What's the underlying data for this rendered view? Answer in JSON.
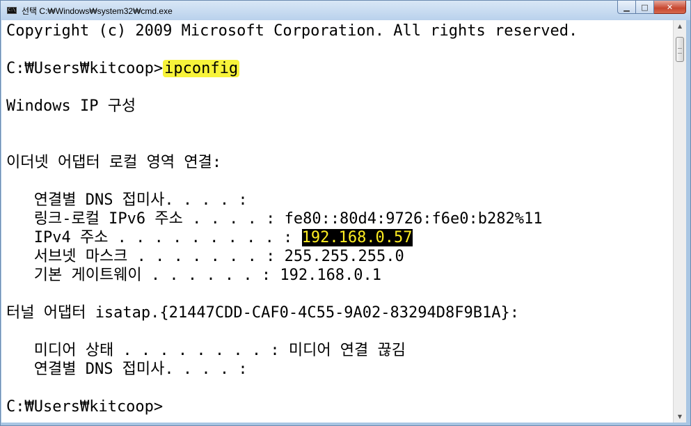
{
  "window": {
    "title": "선택 C:₩Windows₩system32₩cmd.exe",
    "icon_label": "C:\\",
    "buttons": {
      "minimize": "▁",
      "maximize": "□",
      "close": "✕"
    }
  },
  "console": {
    "lines": [
      "Copyright (c) 2009 Microsoft Corporation. All rights reserved.",
      "",
      "C:₩Users₩kitcoop>",
      "",
      "Windows IP 구성",
      "",
      "",
      "이더넷 어댑터 로컬 영역 연결:",
      "",
      "   연결별 DNS 접미사. . . . :",
      "   링크-로컬 IPv6 주소 . . . . : fe80::80d4:9726:f6e0:b282%11",
      "   IPv4 주소 . . . . . . . . . : ",
      "   서브넷 마스크 . . . . . . . : 255.255.255.0",
      "   기본 게이트웨이 . . . . . . : 192.168.0.1",
      "",
      "터널 어댑터 isatap.{21447CDD-CAF0-4C55-9A02-83294D8F9B1A}:",
      "",
      "   미디어 상태 . . . . . . . . : 미디어 연결 끊김",
      "   연결별 DNS 접미사. . . . :",
      "",
      "C:₩Users₩kitcoop>"
    ],
    "command": "ipconfig",
    "ipv4_address": "192.168.0.57"
  },
  "scrollbar": {
    "up_arrow": "▲",
    "down_arrow": "▼"
  },
  "colors": {
    "title_bg": "#c8dcf2",
    "selection_bg": "#000000",
    "selection_fg": "#ffee22",
    "marker": "#f7f33a"
  }
}
